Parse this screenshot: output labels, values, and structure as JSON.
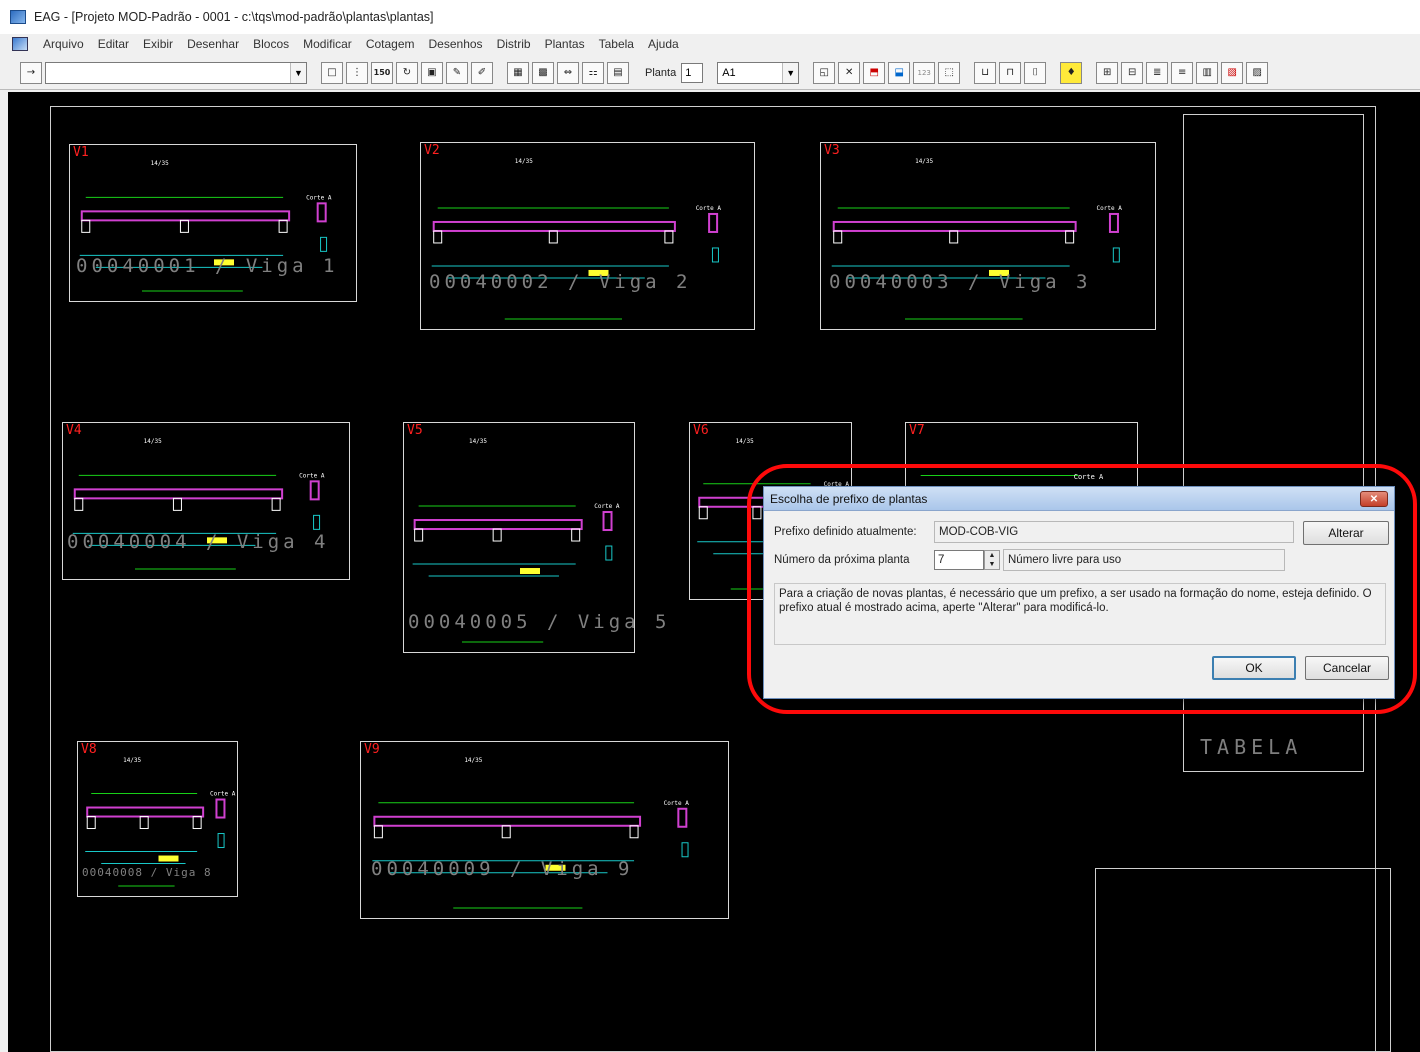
{
  "window": {
    "title": "EAG - [Projeto MOD-Padrão - 0001 - c:\\tqs\\mod-padrão\\plantas\\plantas]"
  },
  "menu": [
    "Arquivo",
    "Editar",
    "Exibir",
    "Desenhar",
    "Blocos",
    "Modificar",
    "Cotagem",
    "Desenhos",
    "Distrib",
    "Plantas",
    "Tabela",
    "Ajuda"
  ],
  "toolbar": {
    "combo_value": "",
    "scale_label": "150",
    "planta_label": "Planta",
    "planta_value": "1",
    "format_value": "A1"
  },
  "drawing": {
    "beams": [
      {
        "id": "V1",
        "watermark": "00040001 / Viga 1"
      },
      {
        "id": "V2",
        "watermark": "00040002 / Viga 2"
      },
      {
        "id": "V3",
        "watermark": "00040003 / Viga 3"
      },
      {
        "id": "V4",
        "watermark": "00040004 / Viga 4"
      },
      {
        "id": "V5",
        "watermark": "00040005 / Viga 5"
      },
      {
        "id": "V6",
        "watermark": ""
      },
      {
        "id": "V7",
        "watermark": ""
      },
      {
        "id": "V8",
        "watermark": "00040008 / Viga 8"
      },
      {
        "id": "V9",
        "watermark": "00040009 / Viga 9"
      }
    ],
    "section_label": "Corte A",
    "dim_label": "14/35",
    "tabela_label": "TABELA"
  },
  "dialog": {
    "title": "Escolha de prefixo de plantas",
    "prefix_label": "Prefixo definido atualmente:",
    "prefix_value": "MOD-COB-VIG",
    "alterar_label": "Alterar",
    "next_label": "Número da próxima planta",
    "next_value": "7",
    "free_label": "Número livre para uso",
    "message": "Para a criação de novas plantas, é necessário que um prefixo, a ser usado na formação do nome, esteja definido. O prefixo atual é mostrado acima, aperte \"Alterar\" para modificá-lo.",
    "ok_label": "OK",
    "cancel_label": "Cancelar"
  },
  "colors": {
    "highlight": "#ff0a0a",
    "beam_id": "#ff2020",
    "beam_body": "#d040d0",
    "rebar_green": "#18d018",
    "rebar_cyan": "#18c8c8",
    "label_yellow": "#ffff30"
  }
}
